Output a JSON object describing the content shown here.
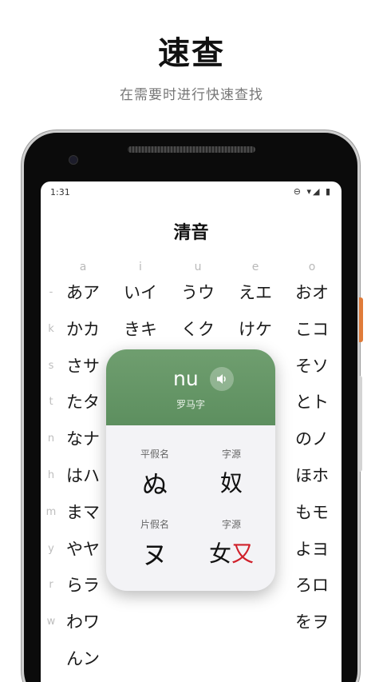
{
  "promo": {
    "title": "速查",
    "subtitle": "在需要时进行快速查找"
  },
  "status_bar": {
    "time": "1:31",
    "icons": "⊖ ▾◢ ▮"
  },
  "screen": {
    "title": "清音"
  },
  "vowels": [
    "a",
    "i",
    "u",
    "e",
    "o"
  ],
  "rows": [
    {
      "consonant": "-",
      "cells": [
        "あア",
        "いイ",
        "うウ",
        "えエ",
        "おオ"
      ]
    },
    {
      "consonant": "k",
      "cells": [
        "かカ",
        "きキ",
        "くク",
        "けケ",
        "こコ"
      ]
    },
    {
      "consonant": "s",
      "cells": [
        "さサ",
        "",
        "",
        "",
        "そソ"
      ]
    },
    {
      "consonant": "t",
      "cells": [
        "たタ",
        "",
        "",
        "",
        "とト"
      ]
    },
    {
      "consonant": "n",
      "cells": [
        "なナ",
        "",
        "",
        "",
        "のノ"
      ]
    },
    {
      "consonant": "h",
      "cells": [
        "はハ",
        "",
        "",
        "",
        "ほホ"
      ]
    },
    {
      "consonant": "m",
      "cells": [
        "まマ",
        "",
        "",
        "",
        "もモ"
      ]
    },
    {
      "consonant": "y",
      "cells": [
        "やヤ",
        "",
        "",
        "",
        "よヨ"
      ]
    },
    {
      "consonant": "r",
      "cells": [
        "らラ",
        "",
        "",
        "",
        "ろロ"
      ]
    },
    {
      "consonant": "w",
      "cells": [
        "わワ",
        "",
        "",
        "",
        "をヲ"
      ]
    },
    {
      "consonant": "",
      "cells": [
        "んン",
        "",
        "",
        "",
        ""
      ]
    }
  ],
  "popup": {
    "romaji": "nu",
    "romaji_label": "罗马字",
    "speaker_icon": "speaker-icon",
    "hiragana_label": "平假名",
    "hiragana": "ぬ",
    "hiragana_source_label": "字源",
    "hiragana_source": "奴",
    "katakana_label": "片假名",
    "katakana": "ヌ",
    "katakana_source_label": "字源",
    "katakana_source_left": "女",
    "katakana_source_highlight": "又",
    "header_color": "#6a9a6a",
    "highlight_color": "#d0202a"
  },
  "colors": {
    "accent_orange": "#e07b39",
    "popup_green": "#6a9a6a"
  }
}
